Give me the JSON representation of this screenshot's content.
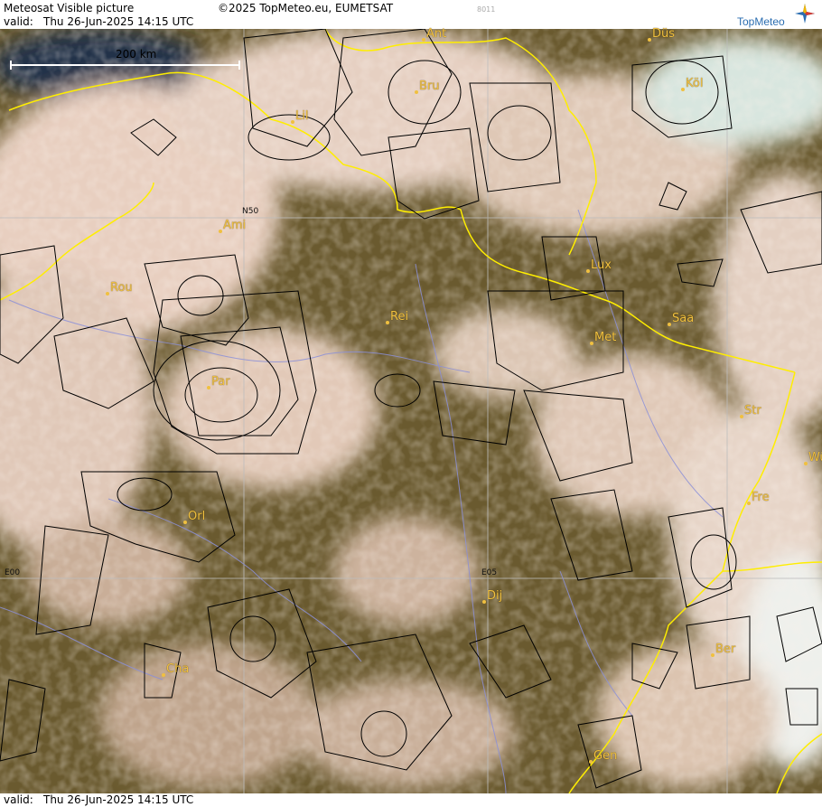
{
  "header": {
    "title": "Meteosat Visible picture",
    "copyright": "©2025 TopMeteo.eu, EUMETSAT",
    "code": "8011",
    "valid_label": "valid:",
    "valid_value": "Thu  26-Jun-2025  14:15 UTC",
    "logo": "TopMeteo"
  },
  "footer": {
    "valid_label": "valid:",
    "valid_value": "Thu  26-Jun-2025  14:15 UTC"
  },
  "map": {
    "scale_bar": "200 km",
    "grid_labels": {
      "n50": "N50",
      "e00": "E00",
      "e05": "E05"
    },
    "colors": {
      "land": "#6b5a2e",
      "cloud": "#e8d4c4",
      "border": "#ffee00",
      "river": "#8c90d8",
      "airspace": "#000000",
      "grid": "#bdbdbd",
      "city": "#f0c040"
    },
    "cities": [
      {
        "name": "Ant"
      },
      {
        "name": "Düs"
      },
      {
        "name": "Bru"
      },
      {
        "name": "Köl"
      },
      {
        "name": "Lil"
      },
      {
        "name": "Ami"
      },
      {
        "name": "Rou"
      },
      {
        "name": "Lux"
      },
      {
        "name": "Rei"
      },
      {
        "name": "Saa"
      },
      {
        "name": "Met"
      },
      {
        "name": "Par"
      },
      {
        "name": "Str"
      },
      {
        "name": "Wü"
      },
      {
        "name": "Fre"
      },
      {
        "name": "Orl"
      },
      {
        "name": "Dij"
      },
      {
        "name": "Ber"
      },
      {
        "name": "Cha"
      },
      {
        "name": "Gen"
      }
    ]
  }
}
